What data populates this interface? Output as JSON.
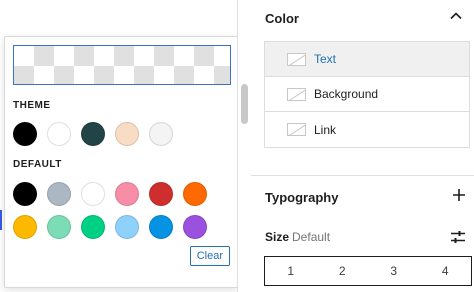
{
  "popover": {
    "theme_label": "THEME",
    "default_label": "DEFAULT",
    "clear_label": "Clear",
    "theme_colors": [
      "#000000",
      "#ffffff",
      "#214447",
      "#f8dcc4",
      "#f4f4f4"
    ],
    "default_colors_row1": [
      "#000000",
      "#abb8c3",
      "#ffffff",
      "#f78da7",
      "#cf2e2e",
      "#ff6900"
    ],
    "default_colors_row2": [
      "#fcb900",
      "#7bdcb5",
      "#00d084",
      "#8ed1fc",
      "#0693e3",
      "#9b51e0"
    ]
  },
  "sidebar": {
    "color_title": "Color",
    "color_items": [
      {
        "label": "Text",
        "active": true
      },
      {
        "label": "Background",
        "active": false
      },
      {
        "label": "Link",
        "active": false
      }
    ],
    "typography_title": "Typography",
    "size_label": "Size",
    "size_value": "Default",
    "size_options": [
      "1",
      "2",
      "3",
      "4"
    ]
  },
  "colors": {
    "accent": "#2271b1",
    "border": "#dddddd"
  }
}
